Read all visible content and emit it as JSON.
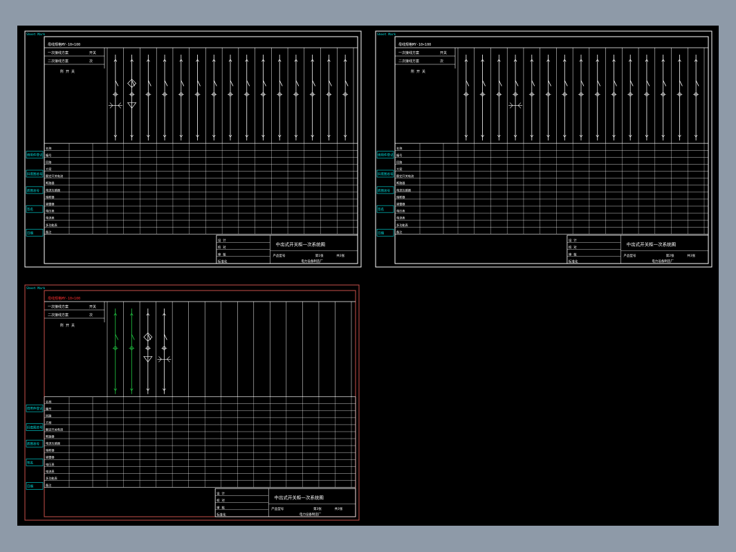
{
  "colors": {
    "background": "#000000",
    "frame_white": "#ffffff",
    "frame_red": "#c8504a",
    "cyan": "#00e5e5",
    "red_text": "#ff3030",
    "green": "#22cc44",
    "workspace": "#8e9aa8"
  },
  "sheets": [
    {
      "id": "sheet-1",
      "busbar_label": "母线规格MY-10×100",
      "primary_label": "一次接线方案",
      "secondary_label": "二次接线方案",
      "secondary_suffix": "次",
      "branch_suffix": "开关",
      "unit_label": "所 开 关",
      "left_tag_top": "Sheet Mark",
      "left_tags": [
        "借用件登记",
        "旧底图总号",
        "底图总号",
        "签名",
        "日期"
      ],
      "row_labels": [
        "名称",
        "编号",
        "回路",
        "方案",
        "额定开关电流",
        "断路器",
        "电流互感器",
        "熔断器",
        "避雷器",
        "电压表",
        "电流表",
        "多功能表",
        "备注"
      ],
      "title_block": {
        "rows": [
          "设 计",
          "校 对",
          "审 核",
          "标准化"
        ],
        "title": "中出式开关柜一次系统图",
        "drawing_no": "产品型号",
        "sheet": "第1张",
        "total": "共3张",
        "company": "电力设备制造厂"
      }
    },
    {
      "id": "sheet-2",
      "busbar_label": "母线规格MY-10×100",
      "primary_label": "一次接线方案",
      "secondary_label": "二次接线方案",
      "secondary_suffix": "次",
      "branch_suffix": "开关",
      "unit_label": "所 开 关",
      "left_tag_top": "Sheet Mark",
      "left_tags": [
        "借用件登记",
        "旧底图总号",
        "底图总号",
        "签名",
        "日期"
      ],
      "row_labels": [
        "名称",
        "编号",
        "回路",
        "方案",
        "额定开关电流",
        "断路器",
        "电流互感器",
        "熔断器",
        "避雷器",
        "电压表",
        "电流表",
        "多功能表",
        "备注"
      ],
      "title_block": {
        "rows": [
          "设 计",
          "校 对",
          "审 核",
          "标准化"
        ],
        "title": "中出式开关柜一次系统图",
        "drawing_no": "产品型号",
        "sheet": "第2张",
        "total": "共3张",
        "company": "电力设备制造厂"
      }
    },
    {
      "id": "sheet-3",
      "busbar_label": "母线规格MY-10×100",
      "primary_label": "一次接线方案",
      "secondary_label": "二次接线方案",
      "secondary_suffix": "次",
      "branch_suffix": "开关",
      "unit_label": "所 开 关",
      "left_tag_top": "Sheet Mark",
      "left_tags": [
        "借用件登记",
        "旧底图总号",
        "底图总号",
        "签名",
        "日期"
      ],
      "row_labels": [
        "名称",
        "编号",
        "回路",
        "方案",
        "额定开关电流",
        "断路器",
        "电流互感器",
        "熔断器",
        "避雷器",
        "电压表",
        "电流表",
        "多功能表",
        "备注"
      ],
      "title_block": {
        "rows": [
          "设 计",
          "校 对",
          "审 核",
          "标准化"
        ],
        "title": "中出式开关柜一次系统图",
        "drawing_no": "产品型号",
        "sheet": "第3张",
        "total": "共3张",
        "company": "电力设备制造厂"
      }
    }
  ]
}
